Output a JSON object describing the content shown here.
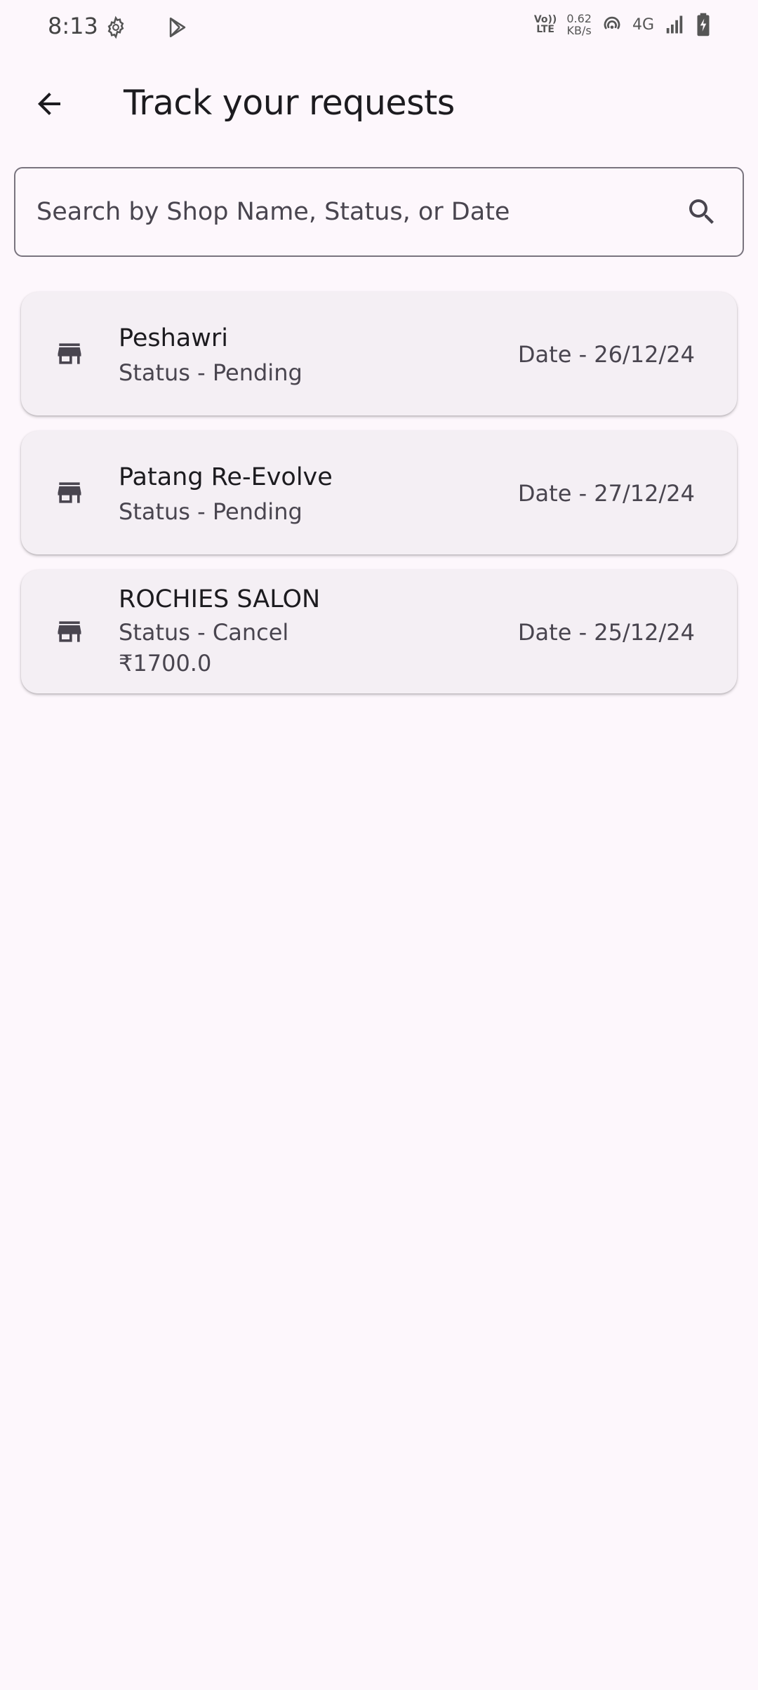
{
  "status_bar": {
    "time": "8:13",
    "volte_top": "Vo))",
    "volte_bottom": "LTE",
    "speed_value": "0.62",
    "speed_unit": "KB/s",
    "network": "4G",
    "icons": [
      "settings-gear-icon",
      "play-store-icon",
      "volte-icon",
      "hotspot-icon",
      "signal-icon",
      "battery-charging-icon"
    ]
  },
  "app_bar": {
    "title": "Track your requests",
    "back_icon": "arrow-back-icon"
  },
  "search": {
    "placeholder": "Search by Shop Name, Status, or Date",
    "icon": "search-icon"
  },
  "requests": [
    {
      "shop": "Peshawri",
      "status": "Status - Pending",
      "date": "Date - 26/12/24",
      "price": "",
      "icon": "store-icon"
    },
    {
      "shop": "Patang Re-Evolve",
      "status": "Status - Pending",
      "date": "Date - 27/12/24",
      "price": "",
      "icon": "store-icon"
    },
    {
      "shop": "ROCHIES SALON",
      "status": "Status - Cancel",
      "date": "Date - 25/12/24",
      "price": "₹1700.0",
      "icon": "store-icon"
    }
  ],
  "colors": {
    "background": "#fdf7fc",
    "card": "#f4eff4",
    "primary_text": "#1c1b1f",
    "secondary_text": "#49454f",
    "outline": "#79747e"
  }
}
